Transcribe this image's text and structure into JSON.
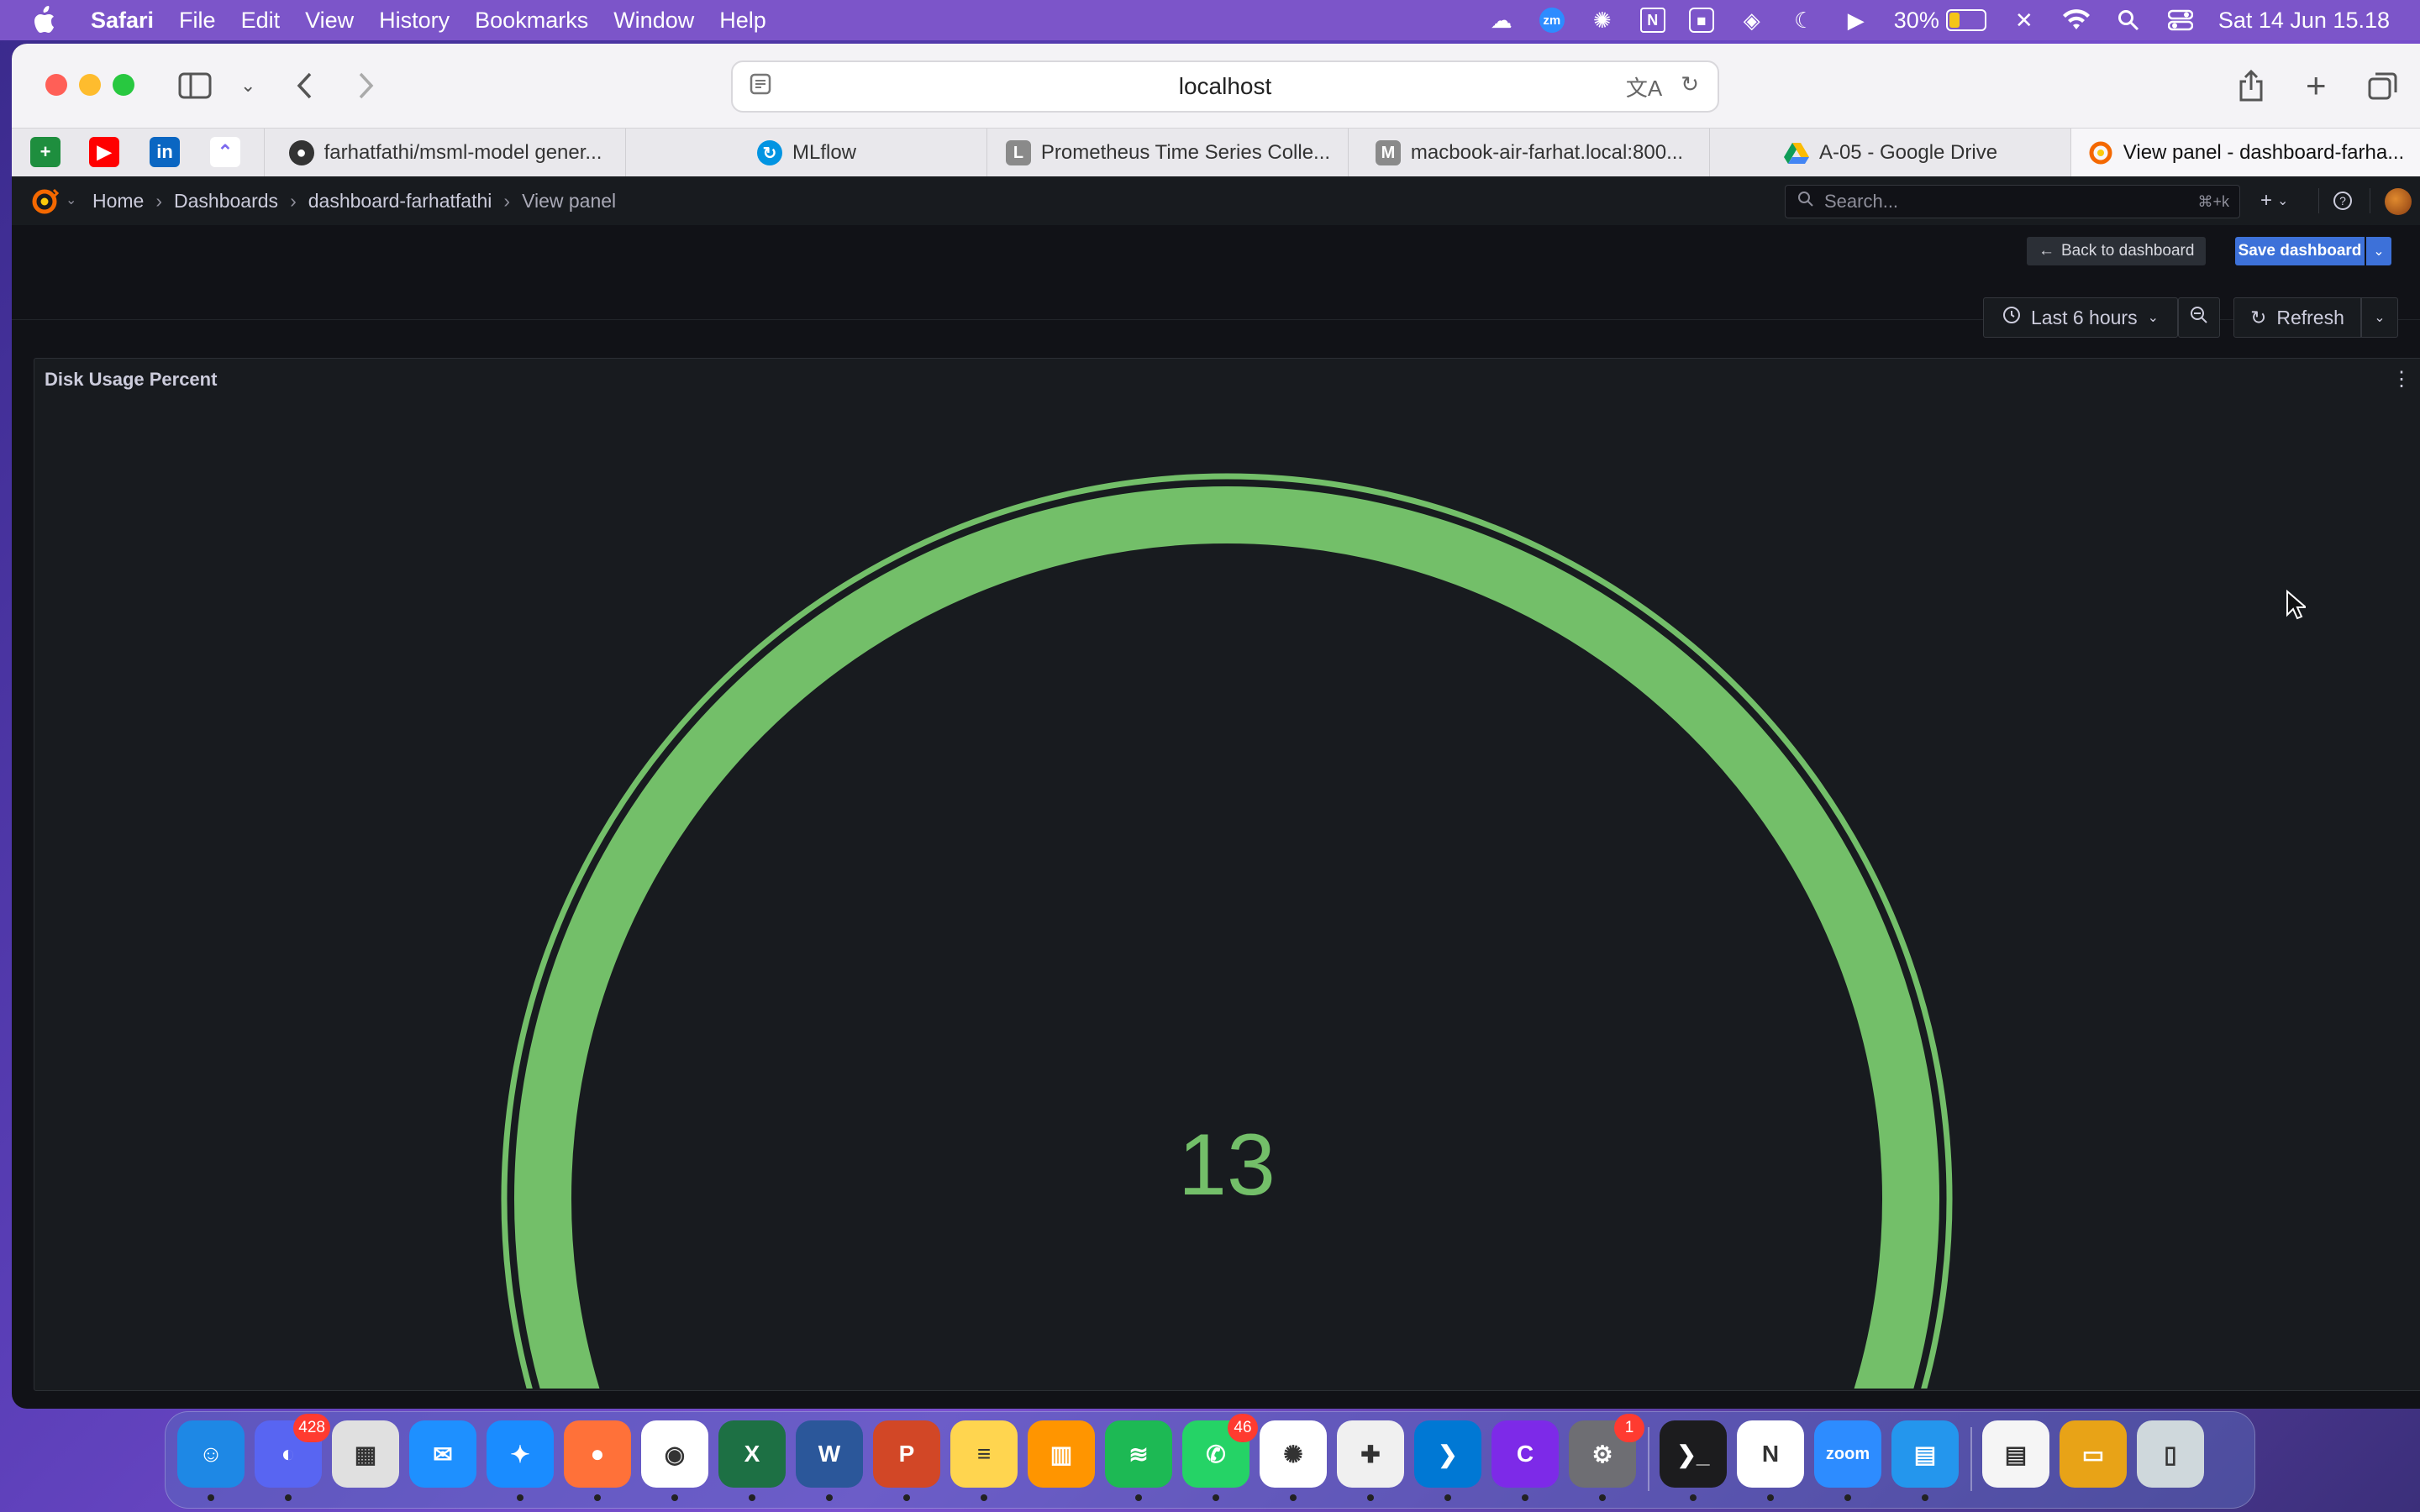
{
  "menubar": {
    "app_name": "Safari",
    "items": [
      "File",
      "Edit",
      "View",
      "History",
      "Bookmarks",
      "Window",
      "Help"
    ],
    "battery": "30%",
    "clock": "Sat 14 Jun  15.18"
  },
  "browser": {
    "url": "localhost",
    "tabs": [
      {
        "title": "farhatfathi/msml-model gener..."
      },
      {
        "title": "MLflow"
      },
      {
        "title": "Prometheus Time Series Colle..."
      },
      {
        "title": "macbook-air-farhat.local:800..."
      },
      {
        "title": "A-05 - Google Drive"
      },
      {
        "title": "View panel - dashboard-farha..."
      }
    ]
  },
  "grafana": {
    "breadcrumb": {
      "home": "Home",
      "dashboards": "Dashboards",
      "dashboard": "dashboard-farhatfathi",
      "current": "View panel"
    },
    "search_placeholder": "Search...",
    "search_shortcut": "⌘+k",
    "back_label": "Back to dashboard",
    "save_label": "Save dashboard",
    "time_range": "Last 6 hours",
    "refresh_label": "Refresh"
  },
  "panel": {
    "title": "Disk Usage Percent",
    "value": "13",
    "gauge_fill_fraction": 1.0,
    "color": "#73bf69"
  },
  "dock": {
    "badges": {
      "discord": "428",
      "whatsapp": "46",
      "settings": "1"
    },
    "apps": [
      "finder-icon",
      "discord-icon",
      "launchpad-icon",
      "mail-icon",
      "safari-icon",
      "firefox-icon",
      "chrome-icon",
      "excel-icon",
      "word-icon",
      "powerpoint-icon",
      "notes-icon",
      "books-icon",
      "spotify-icon",
      "whatsapp-icon",
      "chatgpt-icon",
      "tableau-icon",
      "vscode-icon",
      "canva-icon",
      "system-settings-icon",
      "terminal-icon",
      "notion-icon",
      "zoom-icon",
      "docker-icon",
      "documents-icon",
      "drive-icon",
      "trash-icon"
    ]
  }
}
